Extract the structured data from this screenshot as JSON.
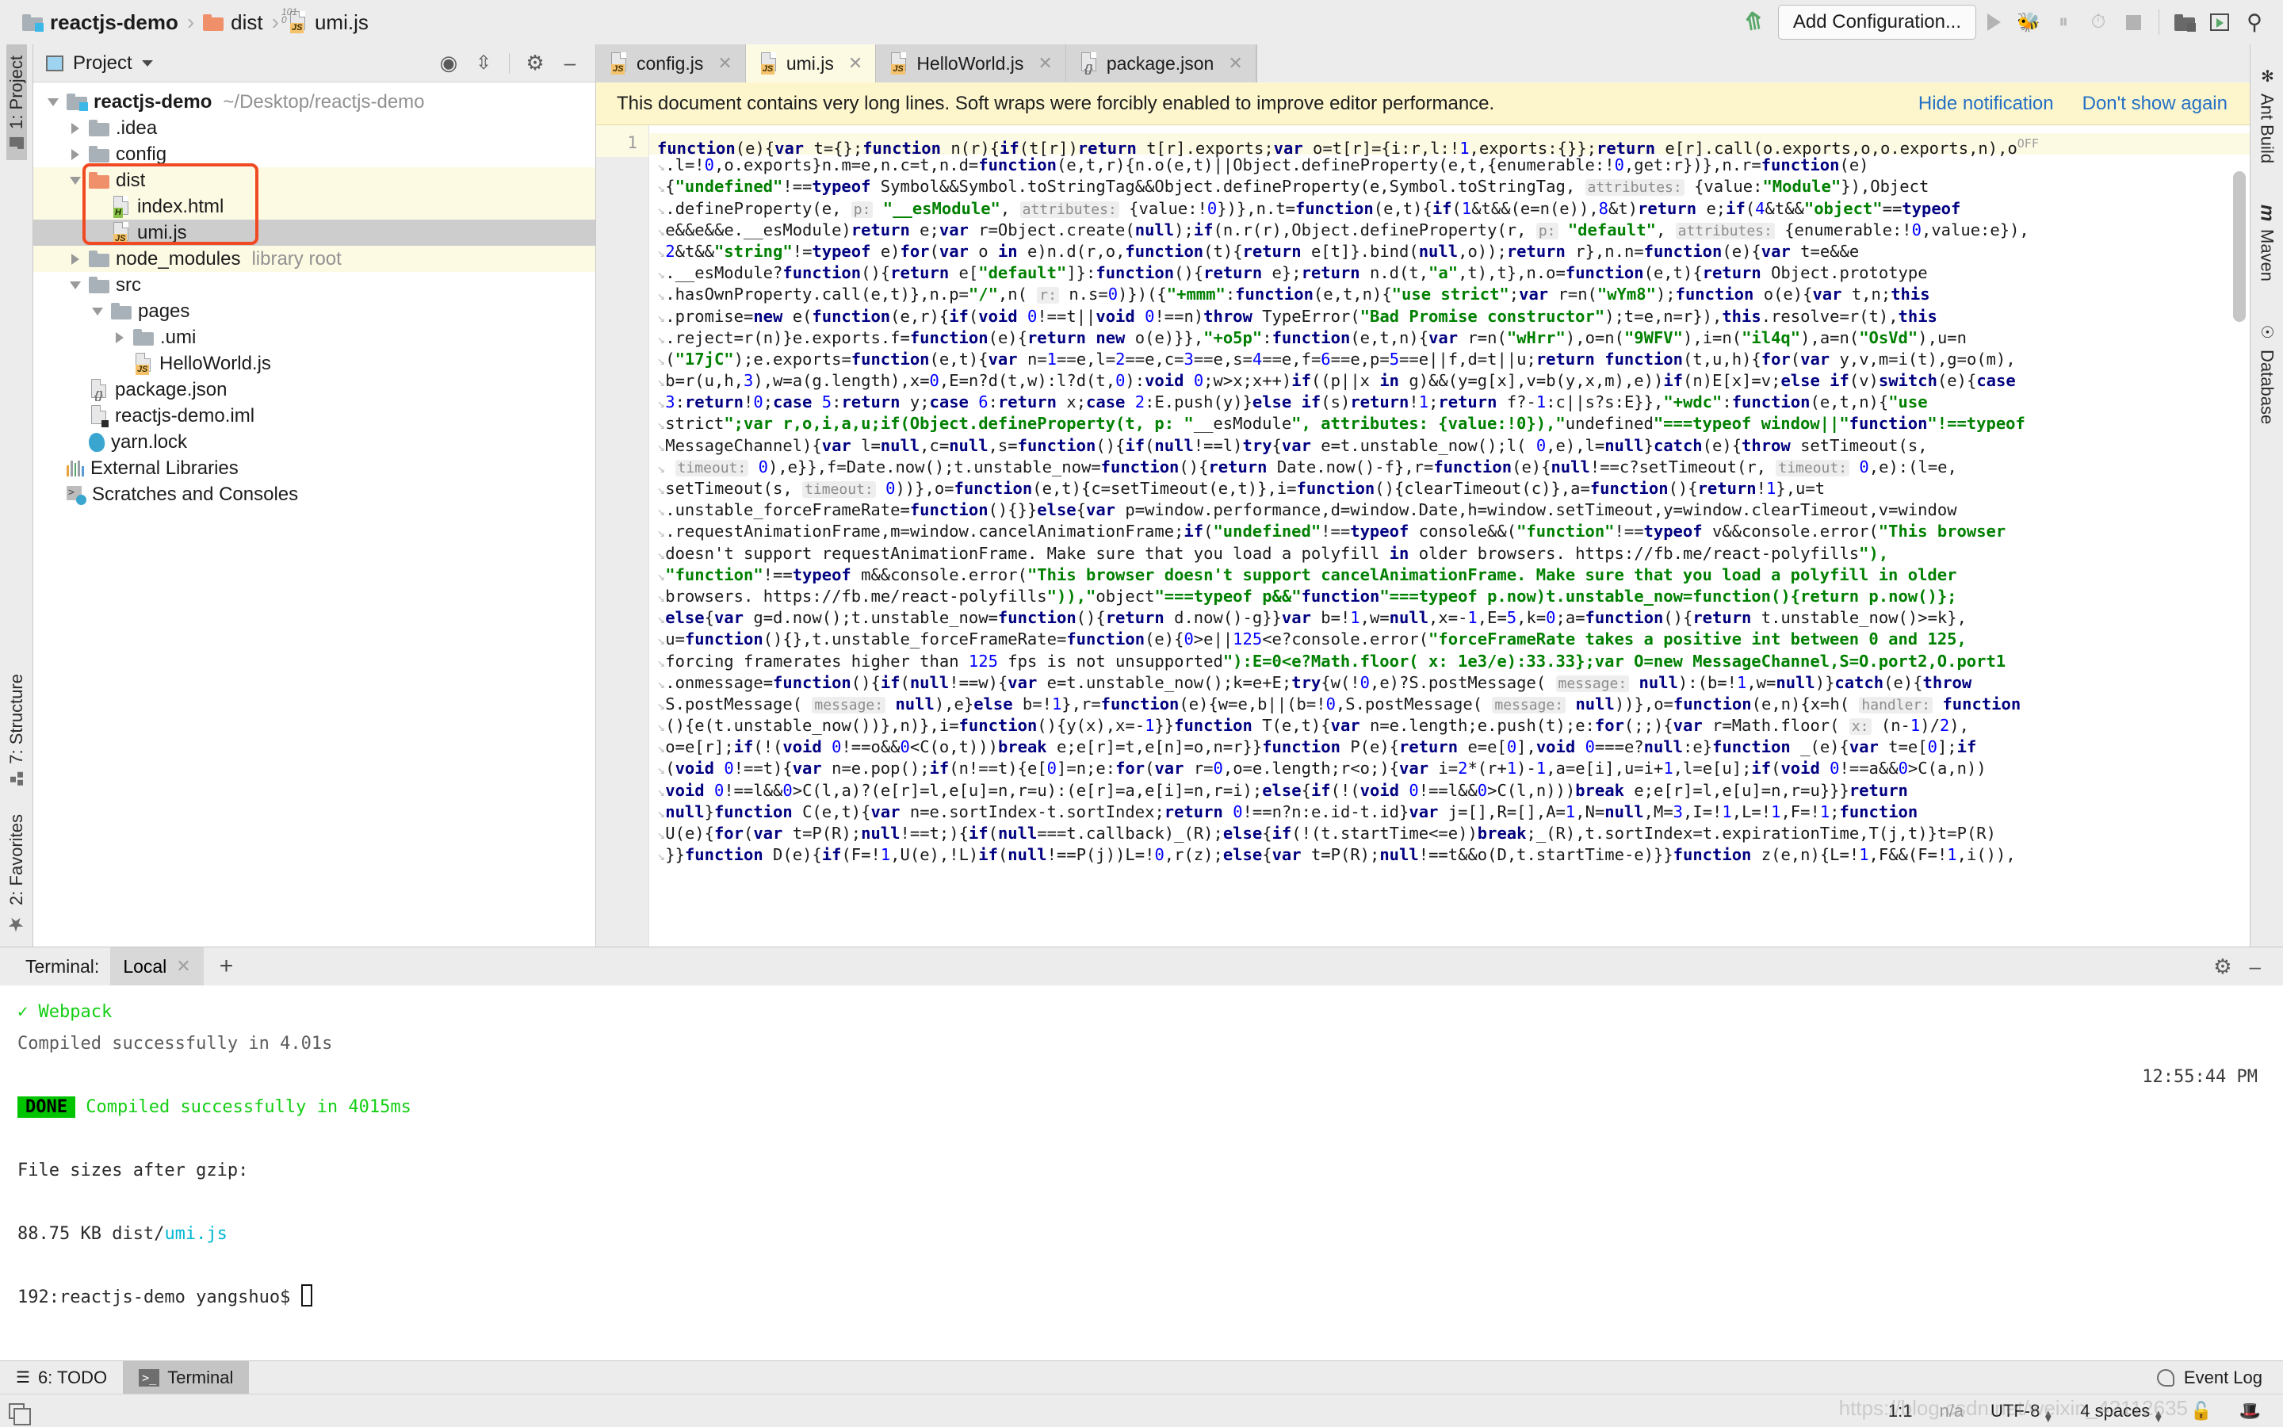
{
  "breadcrumb": {
    "items": [
      {
        "label": "reactjs-demo",
        "icon": "project-folder-icon",
        "bold": true
      },
      {
        "label": "dist",
        "icon": "folder-orange-icon",
        "bold": false
      },
      {
        "label": "umi.js",
        "icon": "js-file-icon",
        "bold": false
      }
    ],
    "separator": "›"
  },
  "toolbar": {
    "add_configuration": "Add Configuration...",
    "icons": [
      "back-arrow-icon",
      "run-icon",
      "debug-icon",
      "run-coverage-icon",
      "profile-icon",
      "stop-icon",
      "project-structure-icon",
      "run-anything-icon",
      "search-everywhere-icon"
    ]
  },
  "left_stripe": {
    "top": {
      "label": "1: Project",
      "shortcut": "1",
      "icon": "folder-icon",
      "active": true
    },
    "bottom": [
      {
        "label": "7: Structure",
        "shortcut": "7",
        "icon": "structure-icon"
      },
      {
        "label": "2: Favorites",
        "shortcut": "2",
        "icon": "star-icon"
      }
    ]
  },
  "right_stripe": {
    "items": [
      {
        "label": "Ant Build",
        "icon": "ant-icon"
      },
      {
        "label": "Maven",
        "icon": "maven-icon"
      },
      {
        "label": "Database",
        "icon": "database-icon"
      }
    ]
  },
  "project_panel": {
    "title": "Project",
    "header_icons": [
      "locate-icon",
      "collapse-all-icon",
      "gear-icon",
      "minimize-icon"
    ],
    "tree": [
      {
        "indent": 0,
        "arrow": "down",
        "icon": "project-folder-icon",
        "name": "reactjs-demo",
        "bold": true,
        "sub": "~/Desktop/reactjs-demo",
        "bg": "none"
      },
      {
        "indent": 1,
        "arrow": "right",
        "icon": "folder-icon",
        "name": ".idea",
        "bold": false,
        "sub": "",
        "bg": "none"
      },
      {
        "indent": 1,
        "arrow": "right",
        "icon": "folder-icon",
        "name": "config",
        "bold": false,
        "sub": "",
        "bg": "none"
      },
      {
        "indent": 1,
        "arrow": "down",
        "icon": "folder-orange-icon",
        "name": "dist",
        "bold": false,
        "sub": "",
        "bg": "yellow"
      },
      {
        "indent": 2,
        "arrow": "none",
        "icon": "html-file-icon",
        "name": "index.html",
        "bold": false,
        "sub": "",
        "bg": "yellow"
      },
      {
        "indent": 2,
        "arrow": "none",
        "icon": "js-file-icon",
        "name": "umi.js",
        "bold": false,
        "sub": "",
        "bg": "sel"
      },
      {
        "indent": 1,
        "arrow": "right",
        "icon": "folder-icon",
        "name": "node_modules",
        "bold": false,
        "sub": "library root",
        "bg": "yellow"
      },
      {
        "indent": 1,
        "arrow": "down",
        "icon": "folder-icon",
        "name": "src",
        "bold": false,
        "sub": "",
        "bg": "none"
      },
      {
        "indent": 2,
        "arrow": "down",
        "icon": "folder-icon",
        "name": "pages",
        "bold": false,
        "sub": "",
        "bg": "none"
      },
      {
        "indent": 3,
        "arrow": "right",
        "icon": "folder-icon",
        "name": ".umi",
        "bold": false,
        "sub": "",
        "bg": "none"
      },
      {
        "indent": 3,
        "arrow": "none",
        "icon": "js-file-icon",
        "name": "HelloWorld.js",
        "bold": false,
        "sub": "",
        "bg": "none"
      },
      {
        "indent": 1,
        "arrow": "none",
        "icon": "json-file-icon",
        "name": "package.json",
        "bold": false,
        "sub": "",
        "bg": "none"
      },
      {
        "indent": 1,
        "arrow": "none",
        "icon": "iml-file-icon",
        "name": "reactjs-demo.iml",
        "bold": false,
        "sub": "",
        "bg": "none"
      },
      {
        "indent": 1,
        "arrow": "none",
        "icon": "yarn-file-icon",
        "name": "yarn.lock",
        "bold": false,
        "sub": "",
        "bg": "none"
      },
      {
        "indent": 0,
        "arrow": "none",
        "icon": "external-libraries-icon",
        "name": "External Libraries",
        "bold": false,
        "sub": "",
        "bg": "none"
      },
      {
        "indent": 0,
        "arrow": "none",
        "icon": "scratches-icon",
        "name": "Scratches and Consoles",
        "bold": false,
        "sub": "",
        "bg": "none"
      }
    ],
    "highlight_color": "#f04a22"
  },
  "editor": {
    "tabs": [
      {
        "label": "config.js",
        "icon": "js-file-icon",
        "active": false
      },
      {
        "label": "umi.js",
        "icon": "js-file-icon",
        "active": true
      },
      {
        "label": "HelloWorld.js",
        "icon": "js-file-icon",
        "active": false
      },
      {
        "label": "package.json",
        "icon": "json-file-icon",
        "active": false
      }
    ],
    "notification": {
      "message": "This document contains very long lines. Soft wraps were forcibly enabled to improve editor performance.",
      "hide_label": "Hide notification",
      "dont_show_label": "Don't show again"
    },
    "line_number": "1",
    "off_badge": "OFF",
    "code_lines": [
      "function(e){var t={};function n(r){if(t[r])return t[r].exports;var o=t[r]={i:r,l:!1,exports:{}};return e[r].call(o.exports,o,o.exports,n),o",
      ".l=!0,o.exports}n.m=e,n.c=t,n.d=function(e,t,r){n.o(e,t)||Object.defineProperty(e,t,{enumerable:!0,get:r})},n.r=function(e)",
      "{\"undefined\"!==typeof Symbol&&Symbol.toStringTag&&Object.defineProperty(e,Symbol.toStringTag, attributes: {value:\"Module\"}),Object",
      ".defineProperty(e, p: \"__esModule\", attributes: {value:!0})},n.t=function(e,t){if(1&t&&(e=n(e)),8&t)return e;if(4&t&&\"object\"==typeof",
      "e&&e&&e.__esModule)return e;var r=Object.create(null);if(n.r(r),Object.defineProperty(r, p: \"default\", attributes: {enumerable:!0,value:e}),",
      "2&t&&\"string\"!=typeof e)for(var o in e)n.d(r,o,function(t){return e[t]}.bind(null,o));return r},n.n=function(e){var t=e&&e",
      ".__esModule?function(){return e[\"default\"]}:function(){return e};return n.d(t,\"a\",t),t},n.o=function(e,t){return Object.prototype",
      ".hasOwnProperty.call(e,t)},n.p=\"/\",n( r: n.s=0)})({\"+mmm\":function(e,t,n){\"use strict\";var r=n(\"wYm8\");function o(e){var t,n;this",
      ".promise=new e(function(e,r){if(void 0!==t||void 0!==n)throw TypeError(\"Bad Promise constructor\");t=e,n=r}),this.resolve=r(t),this",
      ".reject=r(n)}e.exports.f=function(e){return new o(e)}},\"+o5p\":function(e,t,n){var r=n(\"wHrr\"),o=n(\"9WFV\"),i=n(\"il4q\"),a=n(\"OsVd\"),u=n",
      "(\"17jC\");e.exports=function(e,t){var n=1==e,l=2==e,c=3==e,s=4==e,f=6==e,p=5==e||f,d=t||u;return function(t,u,h){for(var y,v,m=i(t),g=o(m),",
      "b=r(u,h,3),w=a(g.length),x=0,E=n?d(t,w):l?d(t,0):void 0;w>x;x++)if((p||x in g)&&(y=g[x],v=b(y,x,m),e))if(n)E[x]=v;else if(v)switch(e){case",
      "3:return!0;case 5:return y;case 6:return x;case 2:E.push(y)}else if(s)return!1;return f?-1:c||s?s:E}},\"+wdc\":function(e,t,n){\"use",
      "strict\";var r,o,i,a,u;if(Object.defineProperty(t, p: \"__esModule\", attributes: {value:!0}),\"undefined\"===typeof window||\"function\"!==typeof",
      "MessageChannel){var l=null,c=null,s=function(){if(null!==l)try{var e=t.unstable_now();l( 0,e),l=null}catch(e){throw setTimeout(s,",
      " timeout: 0),e}},f=Date.now();t.unstable_now=function(){return Date.now()-f},r=function(e){null!==c?setTimeout(r, timeout: 0,e):(l=e,",
      "setTimeout(s, timeout: 0))},o=function(e,t){c=setTimeout(e,t)},i=function(){clearTimeout(c)},a=function(){return!1},u=t",
      ".unstable_forceFrameRate=function(){}}else{var p=window.performance,d=window.Date,h=window.setTimeout,y=window.clearTimeout,v=window",
      ".requestAnimationFrame,m=window.cancelAnimationFrame;if(\"undefined\"!==typeof console&&(\"function\"!==typeof v&&console.error(\"This browser",
      "doesn't support requestAnimationFrame. Make sure that you load a polyfill in older browsers. https://fb.me/react-polyfills\"),",
      "\"function\"!==typeof m&&console.error(\"This browser doesn't support cancelAnimationFrame. Make sure that you load a polyfill in older",
      "browsers. https://fb.me/react-polyfills\")),\"object\"===typeof p&&\"function\"===typeof p.now)t.unstable_now=function(){return p.now()};",
      "else{var g=d.now();t.unstable_now=function(){return d.now()-g}}var b=!1,w=null,x=-1,E=5,k=0;a=function(){return t.unstable_now()>=k},",
      "u=function(){},t.unstable_forceFrameRate=function(e){0>e||125<e?console.error(\"forceFrameRate takes a positive int between 0 and 125,",
      "forcing framerates higher than 125 fps is not unsupported\"):E=0<e?Math.floor( x: 1e3/e):33.33};var O=new MessageChannel,S=O.port2,O.port1",
      ".onmessage=function(){if(null!==w){var e=t.unstable_now();k=e+E;try{w(!0,e)?S.postMessage( message: null):(b=!1,w=null)}catch(e){throw",
      "S.postMessage( message: null),e}else b=!1},r=function(e){w=e,b||(b=!0,S.postMessage( message: null))},o=function(e,n){x=h( handler: function",
      "(){e(t.unstable_now())},n)},i=function(){y(x),x=-1}}function T(e,t){var n=e.length;e.push(t);e:for(;;){var r=Math.floor( x: (n-1)/2),",
      "o=e[r];if(!(void 0!==o&&0<C(o,t)))break e;e[r]=t,e[n]=o,n=r}}function P(e){return e=e[0],void 0===e?null:e}function _(e){var t=e[0];if",
      "(void 0!==t){var n=e.pop();if(n!==t){e[0]=n;e:for(var r=0,o=e.length;r<o;){var i=2*(r+1)-1,a=e[i],u=i+1,l=e[u];if(void 0!==a&&0>C(a,n))",
      "void 0!==l&&0>C(l,a)?(e[r]=l,e[u]=n,r=u):(e[r]=a,e[i]=n,r=i);else{if(!(void 0!==l&&0>C(l,n)))break e;e[r]=l,e[u]=n,r=u}}}return",
      "null}function C(e,t){var n=e.sortIndex-t.sortIndex;return 0!==n?n:e.id-t.id}var j=[],R=[],A=1,N=null,M=3,I=!1,L=!1,F=!1;function",
      "U(e){for(var t=P(R);null!==t;){if(null===t.callback)_(R);else{if(!(t.startTime<=e))break;_(R),t.sortIndex=t.expirationTime,T(j,t)}t=P(R)",
      "}}function D(e){if(F=!1,U(e),!L)if(null!==P(j))L=!0,r(z);else{var t=P(R);null!==t&&o(D,t.startTime-e)}}function z(e,n){L=!1,F&&(F=!1,i()),"
    ]
  },
  "terminal": {
    "label": "Terminal:",
    "tab": "Local",
    "add_tab": "+",
    "header_icons": [
      "gear-icon",
      "minimize-icon"
    ],
    "timestamp": "12:55:44 PM",
    "lines": [
      {
        "type": "check",
        "text": "Webpack"
      },
      {
        "type": "plain_gray",
        "text": "  Compiled successfully in 4.01s"
      },
      {
        "type": "blank",
        "text": ""
      },
      {
        "type": "done",
        "badge": "DONE",
        "text": "Compiled successfully in 4015ms"
      },
      {
        "type": "blank",
        "text": ""
      },
      {
        "type": "plain",
        "text": "File sizes after gzip:"
      },
      {
        "type": "blank",
        "text": ""
      },
      {
        "type": "filesize",
        "size": "88.75 KB",
        "path_prefix": "dist/",
        "path_file": "umi.js"
      },
      {
        "type": "blank",
        "text": ""
      },
      {
        "type": "prompt",
        "text": "192:reactjs-demo yangshuo$ "
      }
    ]
  },
  "bottom_tabs": [
    {
      "label": "6: TODO",
      "icon": "todo-icon",
      "active": false
    },
    {
      "label": "Terminal",
      "icon": "terminal-icon",
      "active": true
    }
  ],
  "event_log": {
    "label": "Event Log",
    "icon": "event-log-icon"
  },
  "status_bar": {
    "caret": "1:1",
    "na": "n/a",
    "encoding": "UTF-8",
    "indent": "4 spaces",
    "icons": [
      "lock-icon",
      "hat-icon"
    ]
  },
  "watermark": "https://blog.csdn.net/weixin_42112635"
}
